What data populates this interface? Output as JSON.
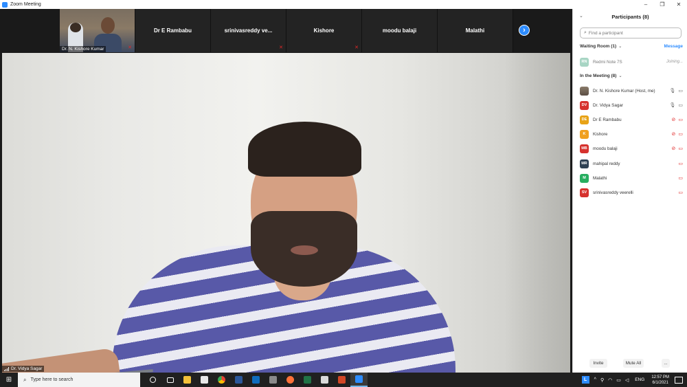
{
  "window": {
    "title": "Zoom Meeting",
    "minimize": "–",
    "maximize": "❐",
    "close": "✕"
  },
  "gallery": {
    "self_name": "Dr. N. Kishore Kumar",
    "tiles": [
      {
        "name": "Dr E Rambabu",
        "muted": true
      },
      {
        "name": "srinivasreddy  ve...",
        "muted": false
      },
      {
        "name": "Kishore",
        "muted": true
      },
      {
        "name": "moodu balaji",
        "muted": true
      },
      {
        "name": "Malathi",
        "muted": false
      }
    ],
    "next_glyph": "›"
  },
  "main_video": {
    "speaker": "Dr. Vidya Sagar"
  },
  "participants": {
    "title": "Participants (8)",
    "search_placeholder": "Find a participant",
    "waiting_room": {
      "label": "Waiting Room (1)",
      "message_label": "Message",
      "people": [
        {
          "initials": "RN",
          "name": "Redmi Note 7S",
          "status": "Joining...",
          "color": "#a8d5c4"
        }
      ]
    },
    "in_meeting": {
      "label": "In the Meeting (8)",
      "people": [
        {
          "initials": "",
          "name": "Dr. N. Kishore Kumar (Host, me)",
          "color": "#7a6a5a",
          "mic": "on",
          "video": "on"
        },
        {
          "initials": "DV",
          "name": "Dr. Vidya Sagar",
          "color": "#d6322e",
          "mic": "on",
          "video": "on"
        },
        {
          "initials": "DE",
          "name": "Dr E Rambabu",
          "color": "#e8a317",
          "mic": "off",
          "video": "off"
        },
        {
          "initials": "K",
          "name": "Kishore",
          "color": "#f0a020",
          "mic": "off",
          "video": "off"
        },
        {
          "initials": "MB",
          "name": "moodu balaji",
          "color": "#d6322e",
          "mic": "off",
          "video": "off"
        },
        {
          "initials": "MR",
          "name": "mahipal reddy",
          "color": "#2e4053",
          "mic": "none",
          "video": "off"
        },
        {
          "initials": "M",
          "name": "Malathi",
          "color": "#27ae60",
          "mic": "none",
          "video": "off"
        },
        {
          "initials": "SV",
          "name": "srinivasreddy veerelli",
          "color": "#d6322e",
          "mic": "none",
          "video": "off"
        }
      ]
    },
    "footer": {
      "invite": "Invite",
      "mute_all": "Mute All",
      "more": "..."
    }
  },
  "taskbar": {
    "search_placeholder": "Type here to search",
    "apps": [
      {
        "name": "cortana",
        "color": "#ffffff"
      },
      {
        "name": "task-view",
        "color": "#ffffff"
      },
      {
        "name": "file-explorer",
        "color": "#f3c13a"
      },
      {
        "name": "store",
        "color": "#e8e8e8"
      },
      {
        "name": "chrome",
        "color": "#e94235"
      },
      {
        "name": "word",
        "color": "#2b579a"
      },
      {
        "name": "mail",
        "color": "#0f6cbd"
      },
      {
        "name": "calculator",
        "color": "#8a8a8a"
      },
      {
        "name": "firefox",
        "color": "#ff7139"
      },
      {
        "name": "excel",
        "color": "#217346"
      },
      {
        "name": "notepad",
        "color": "#dadada"
      },
      {
        "name": "powerpoint",
        "color": "#d24726"
      },
      {
        "name": "zoom",
        "color": "#2d8cff"
      }
    ],
    "tray": {
      "lang": "ENG",
      "time": "12:57 PM",
      "date": "6/1/2021"
    }
  }
}
